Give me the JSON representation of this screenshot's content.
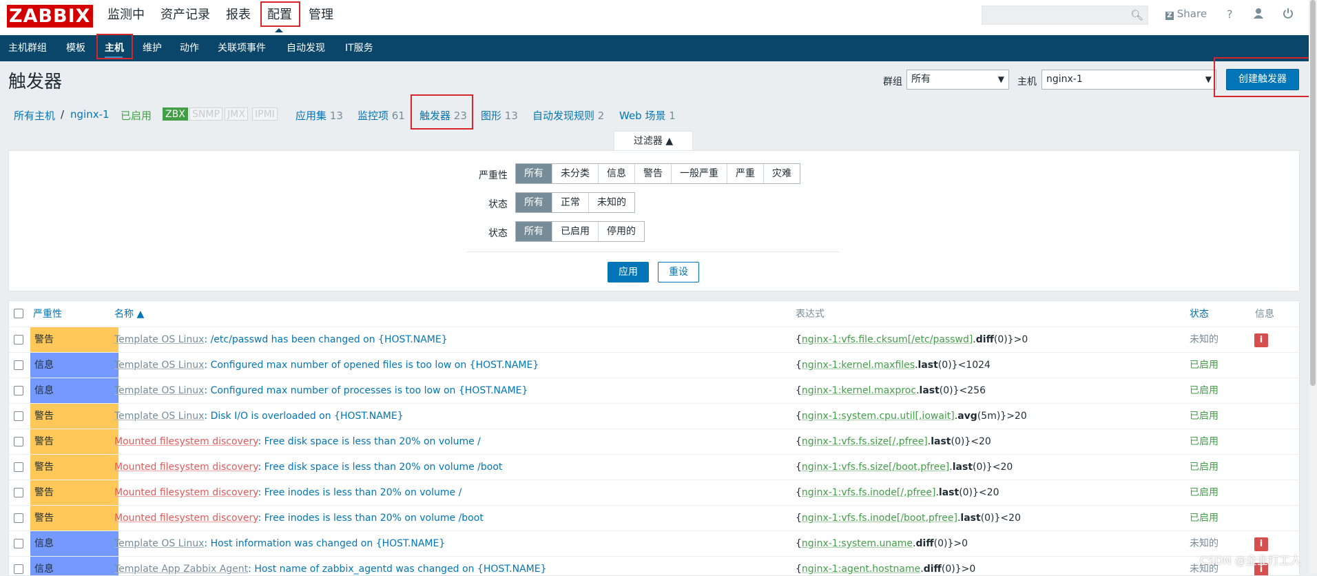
{
  "logo": "ZABBIX",
  "top_nav": [
    "监测中",
    "资产记录",
    "报表",
    "配置",
    "管理"
  ],
  "top_right": {
    "search_placeholder": "",
    "share_label": "Share",
    "help_label": "?"
  },
  "sub_nav": [
    "主机群组",
    "模板",
    "主机",
    "维护",
    "动作",
    "关联项事件",
    "自动发现",
    "IT服务"
  ],
  "page_title": "触发器",
  "controls": {
    "group_label": "群组",
    "group_value": "所有",
    "host_label": "主机",
    "host_value": "nginx-1",
    "create_button": "创建触发器"
  },
  "breadcrumbs": {
    "all_hosts": "所有主机",
    "sep": "/",
    "host": "nginx-1",
    "status": "已启用",
    "badges": [
      "ZBX",
      "SNMP",
      "JMX",
      "IPMI"
    ],
    "tabs": [
      {
        "label": "应用集",
        "count": "13"
      },
      {
        "label": "监控项",
        "count": "61"
      },
      {
        "label": "触发器",
        "count": "23"
      },
      {
        "label": "图形",
        "count": "13"
      },
      {
        "label": "自动发现规则",
        "count": "2"
      },
      {
        "label": "Web 场景",
        "count": "1"
      }
    ]
  },
  "filter": {
    "tab_label": "过滤器 ▲",
    "severity_label": "严重性",
    "severity_options": [
      "所有",
      "未分类",
      "信息",
      "警告",
      "一般严重",
      "严重",
      "灾难"
    ],
    "state_label": "状态",
    "state_options": [
      "所有",
      "正常",
      "未知的"
    ],
    "status_label": "状态",
    "status_options": [
      "所有",
      "已启用",
      "停用的"
    ],
    "apply": "应用",
    "reset": "重设"
  },
  "table": {
    "headers": {
      "severity": "严重性",
      "name": "名称 ▲",
      "expression": "表达式",
      "status": "状态",
      "info": "信息"
    },
    "rows": [
      {
        "severity": "警告",
        "sev_class": "warn",
        "prefix": "Template OS Linux",
        "prefix_type": "tpl",
        "name": "/etc/passwd has been changed on {HOST.NAME}",
        "expr_pre": "{",
        "expr_item": "nginx-1:vfs.file.cksum[/etc/passwd]",
        "expr_fn": "diff",
        "expr_post": "(0)}>0",
        "status": "未知的",
        "status_class": "unknown",
        "info": "i"
      },
      {
        "severity": "信息",
        "sev_class": "info",
        "prefix": "Template OS Linux",
        "prefix_type": "tpl",
        "name": "Configured max number of opened files is too low on {HOST.NAME}",
        "expr_pre": "{",
        "expr_item": "nginx-1:kernel.maxfiles",
        "expr_fn": "last",
        "expr_post": "(0)}<1024",
        "status": "已启用",
        "status_class": "enabled",
        "info": ""
      },
      {
        "severity": "信息",
        "sev_class": "info",
        "prefix": "Template OS Linux",
        "prefix_type": "tpl",
        "name": "Configured max number of processes is too low on {HOST.NAME}",
        "expr_pre": "{",
        "expr_item": "nginx-1:kernel.maxproc",
        "expr_fn": "last",
        "expr_post": "(0)}<256",
        "status": "已启用",
        "status_class": "enabled",
        "info": ""
      },
      {
        "severity": "警告",
        "sev_class": "warn",
        "prefix": "Template OS Linux",
        "prefix_type": "tpl",
        "name": "Disk I/O is overloaded on {HOST.NAME}",
        "expr_pre": "{",
        "expr_item": "nginx-1:system.cpu.util[,iowait]",
        "expr_fn": "avg",
        "expr_post": "(5m)}>20",
        "status": "已启用",
        "status_class": "enabled",
        "info": ""
      },
      {
        "severity": "警告",
        "sev_class": "warn",
        "prefix": "Mounted filesystem discovery",
        "prefix_type": "lld",
        "name": "Free disk space is less than 20% on volume /",
        "expr_pre": "{",
        "expr_item": "nginx-1:vfs.fs.size[/,pfree]",
        "expr_fn": "last",
        "expr_post": "(0)}<20",
        "status": "已启用",
        "status_class": "enabled",
        "info": ""
      },
      {
        "severity": "警告",
        "sev_class": "warn",
        "prefix": "Mounted filesystem discovery",
        "prefix_type": "lld",
        "name": "Free disk space is less than 20% on volume /boot",
        "expr_pre": "{",
        "expr_item": "nginx-1:vfs.fs.size[/boot,pfree]",
        "expr_fn": "last",
        "expr_post": "(0)}<20",
        "status": "已启用",
        "status_class": "enabled",
        "info": ""
      },
      {
        "severity": "警告",
        "sev_class": "warn",
        "prefix": "Mounted filesystem discovery",
        "prefix_type": "lld",
        "name": "Free inodes is less than 20% on volume /",
        "expr_pre": "{",
        "expr_item": "nginx-1:vfs.fs.inode[/,pfree]",
        "expr_fn": "last",
        "expr_post": "(0)}<20",
        "status": "已启用",
        "status_class": "enabled",
        "info": ""
      },
      {
        "severity": "警告",
        "sev_class": "warn",
        "prefix": "Mounted filesystem discovery",
        "prefix_type": "lld",
        "name": "Free inodes is less than 20% on volume /boot",
        "expr_pre": "{",
        "expr_item": "nginx-1:vfs.fs.inode[/boot,pfree]",
        "expr_fn": "last",
        "expr_post": "(0)}<20",
        "status": "已启用",
        "status_class": "enabled",
        "info": ""
      },
      {
        "severity": "信息",
        "sev_class": "info",
        "prefix": "Template OS Linux",
        "prefix_type": "tpl",
        "name": "Host information was changed on {HOST.NAME}",
        "expr_pre": "{",
        "expr_item": "nginx-1:system.uname",
        "expr_fn": "diff",
        "expr_post": "(0)}>0",
        "status": "未知的",
        "status_class": "unknown",
        "info": "i"
      },
      {
        "severity": "信息",
        "sev_class": "info",
        "prefix": "Template App Zabbix Agent",
        "prefix_type": "tpl",
        "name": "Host name of zabbix_agentd was changed on {HOST.NAME}",
        "expr_pre": "{",
        "expr_item": "nginx-1:agent.hostname",
        "expr_fn": "diff",
        "expr_post": "(0)}>0",
        "status": "未知的",
        "status_class": "unknown",
        "info": "i"
      }
    ]
  },
  "watermark": "CSDN @企业打工人",
  "colors": {
    "brand": "#d40000",
    "subnav": "#0a466a",
    "link": "#0275b8",
    "warn": "#ffc859",
    "info": "#7499ff",
    "enabled": "#429e47",
    "highlight": "#d6262a"
  }
}
